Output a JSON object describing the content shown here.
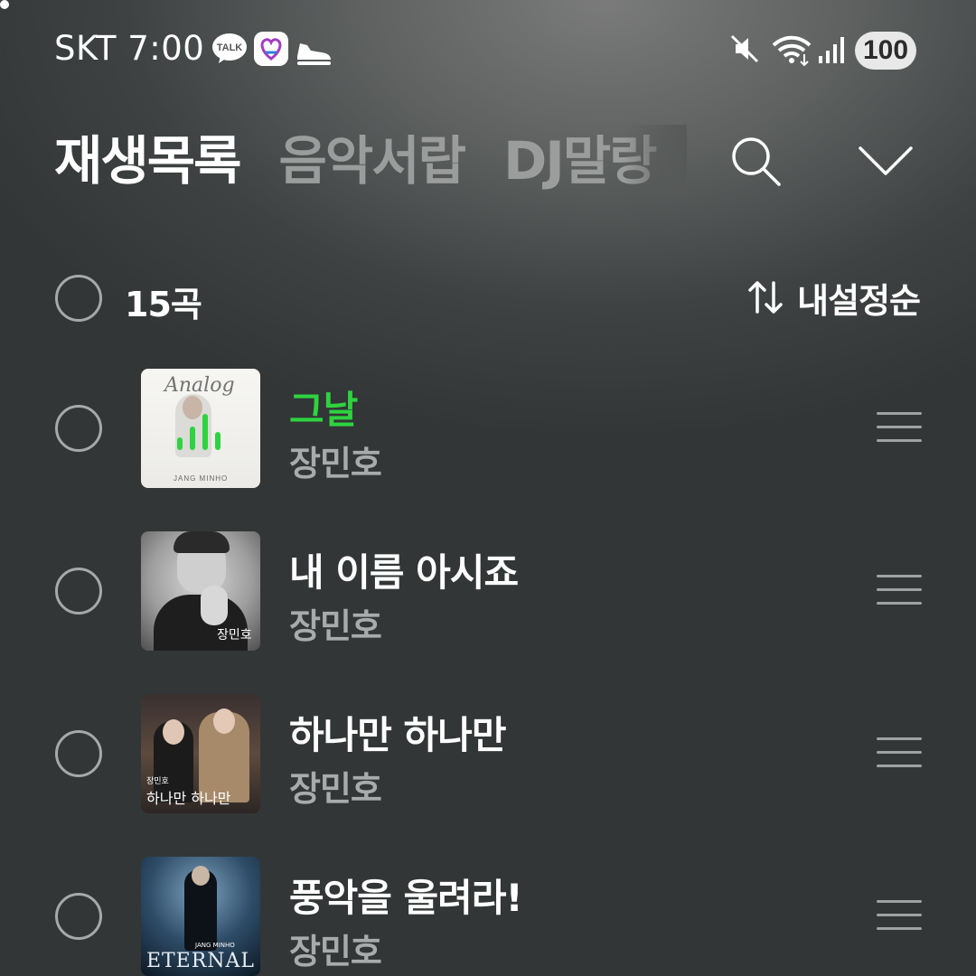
{
  "status_bar": {
    "carrier": "SKT",
    "time": "7:00",
    "talk_label": "TALK",
    "battery": "100"
  },
  "tabs": [
    {
      "label": "재생목록",
      "active": true
    },
    {
      "label": "음악서랍",
      "active": false
    },
    {
      "label": "DJ말랑",
      "active": false
    }
  ],
  "list_header": {
    "count": "15곡",
    "sort_label": "내설정순"
  },
  "songs": [
    {
      "title": "그날",
      "artist": "장민호",
      "playing": true,
      "art_text": "Analog",
      "art_caption": "JANG MINHO"
    },
    {
      "title": "내 이름 아시죠",
      "artist": "장민호",
      "playing": false,
      "art_text": "장민호"
    },
    {
      "title": "하나만 하나만",
      "artist": "장민호",
      "playing": false,
      "art_text": "하나만 하나만",
      "art_caption": "장민호"
    },
    {
      "title": "풍악을 울려라!",
      "artist": "장민호",
      "playing": false,
      "art_text": "ETERNAL",
      "art_caption": "JANG MINHO"
    }
  ],
  "colors": {
    "accent_green": "#2ed33f",
    "inactive_tab": "#9a9d9c",
    "artist_gray": "#a9abaa"
  },
  "icons": [
    "talk-icon",
    "heart-icon",
    "shoe-icon",
    "mute-icon",
    "wifi-icon",
    "signal-icon",
    "search-icon",
    "chevron-down-icon",
    "sort-icon",
    "drag-handle-icon",
    "equalizer-icon"
  ]
}
